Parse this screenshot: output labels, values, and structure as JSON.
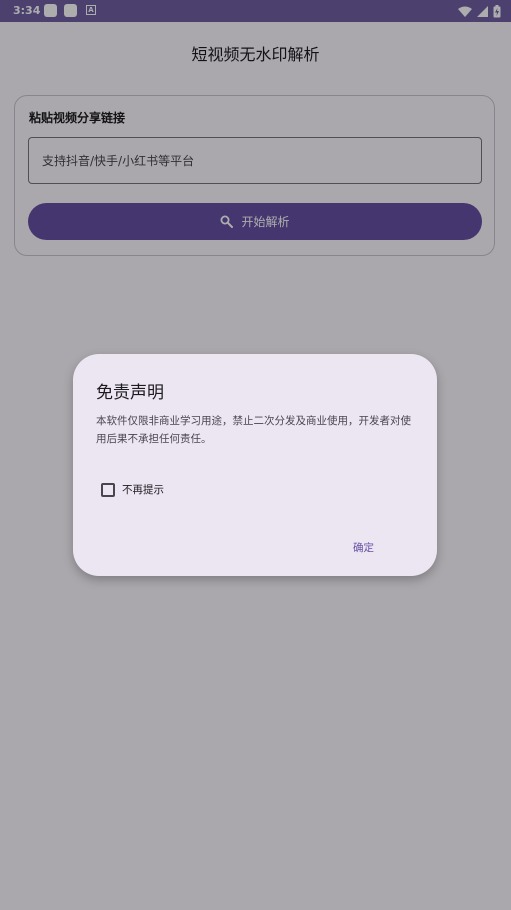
{
  "status_bar": {
    "time": "3:34",
    "notification_icons": [
      "app-icon",
      "app-icon",
      "a-icon"
    ],
    "a_glyph": "A",
    "right_icons": [
      "wifi-icon",
      "signal-icon",
      "battery-charging-icon"
    ]
  },
  "app": {
    "title": "短视频无水印解析"
  },
  "form": {
    "section_label": "粘贴视频分享链接",
    "input_value": "",
    "input_placeholder": "支持抖音/快手/小红书等平台",
    "parse_button_label": "开始解析",
    "parse_button_icon": "search-icon"
  },
  "dialog": {
    "title": "免责声明",
    "body": "本软件仅限非商业学习用途，禁止二次分发及商业使用，开发者对使用后果不承担任何责任。",
    "checkbox_label": "不再提示",
    "checkbox_checked": false,
    "confirm_label": "确定"
  },
  "colors": {
    "primary": "#6650a4",
    "dialog_surface": "#ece6f3",
    "status_bar": "#6f5fa3",
    "scrim": "rgba(0,0,0,0.32)"
  }
}
